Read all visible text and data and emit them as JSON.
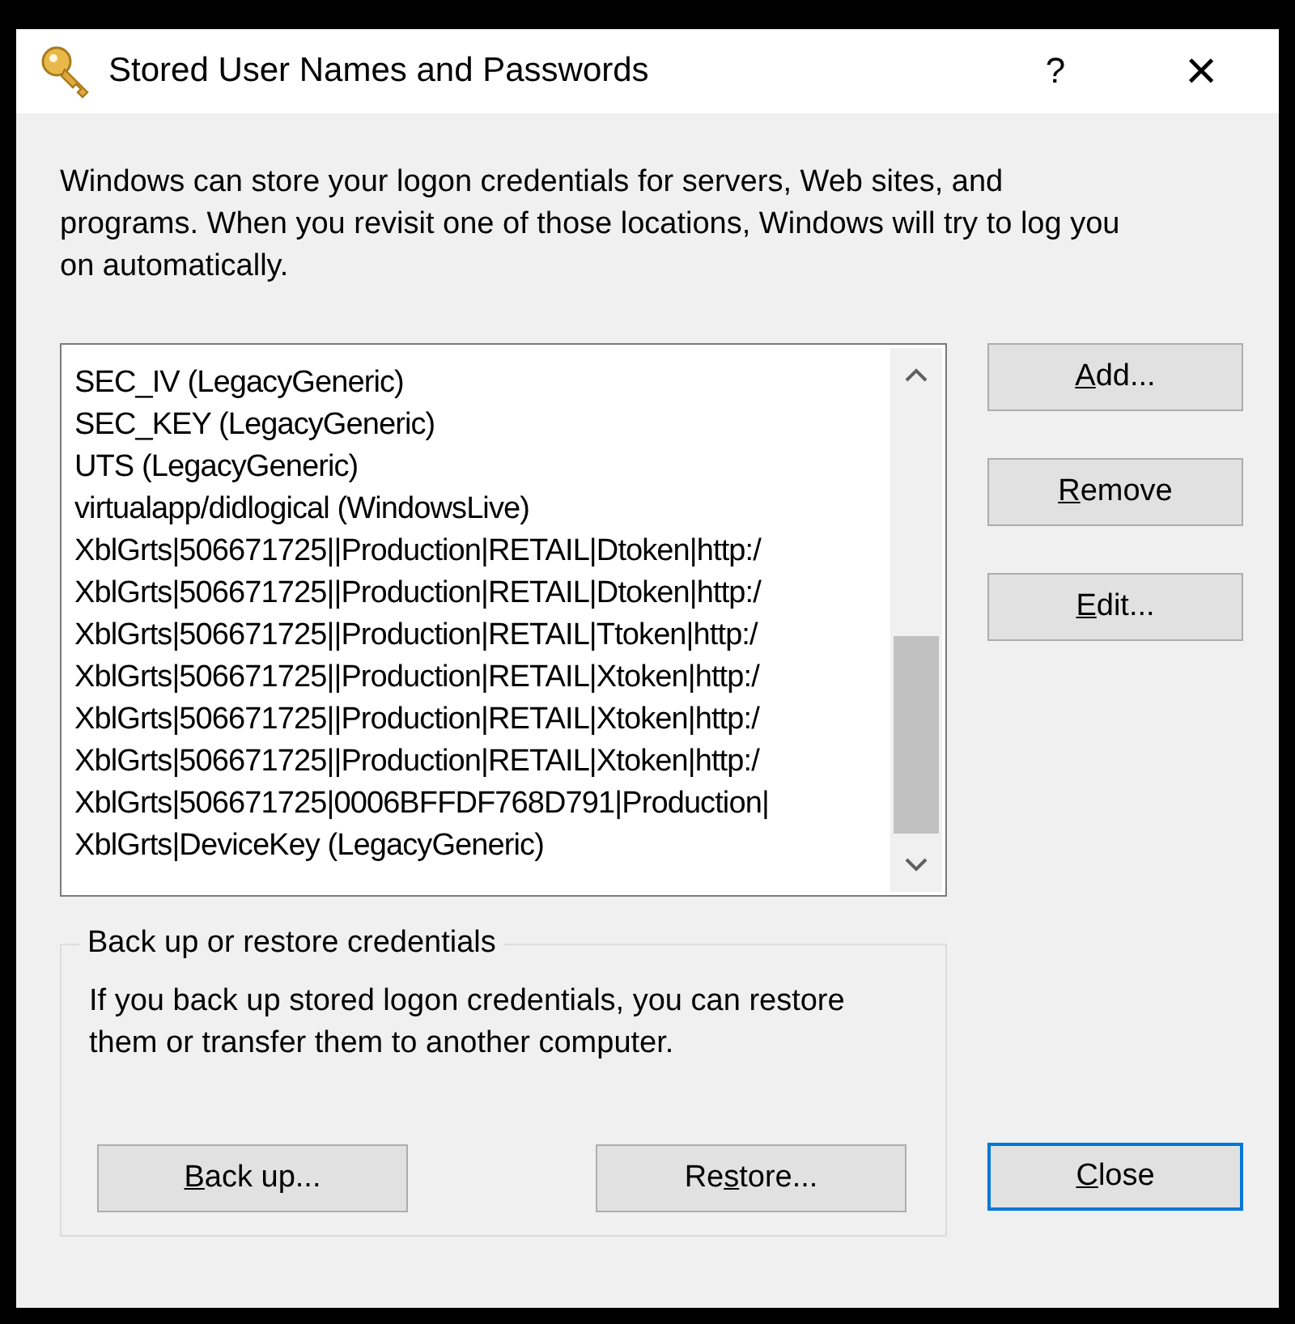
{
  "window": {
    "title": "Stored User Names and Passwords",
    "help": "?",
    "close": "×"
  },
  "description": "Windows can store your logon credentials for servers, Web sites, and programs. When you revisit one of those locations, Windows will try to log you on automatically.",
  "credentials": [
    {
      "name": "SEC_IV (LegacyGeneric)",
      "selected": false
    },
    {
      "name": "SEC_KEY (LegacyGeneric)",
      "selected": false
    },
    {
      "name": "UTS (LegacyGeneric)",
      "selected": false
    },
    {
      "name": "virtualapp/didlogical (WindowsLive)",
      "selected": false
    },
    {
      "name": "XblGrts|506671725||Production|RETAIL|Dtoken|http:/",
      "selected": false
    },
    {
      "name": "XblGrts|506671725||Production|RETAIL|Dtoken|http:/",
      "selected": false
    },
    {
      "name": "XblGrts|506671725||Production|RETAIL|Ttoken|http:/",
      "selected": false
    },
    {
      "name": "XblGrts|506671725||Production|RETAIL|Xtoken|http:/",
      "selected": false
    },
    {
      "name": "XblGrts|506671725||Production|RETAIL|Xtoken|http:/",
      "selected": false
    },
    {
      "name": "XblGrts|506671725||Production|RETAIL|Xtoken|http:/",
      "selected": false
    },
    {
      "name": "XblGrts|506671725|0006BFFDF768D791|Production|",
      "selected": false
    },
    {
      "name": "XblGrts|DeviceKey (LegacyGeneric)",
      "selected": false
    }
  ],
  "side_buttons": [
    {
      "label": {
        "key": "A",
        "after": "dd..."
      },
      "default": false
    },
    {
      "label": {
        "key": "R",
        "after": "emove"
      },
      "default": false
    },
    {
      "label": {
        "key": "E",
        "after": "dit..."
      },
      "default": false
    }
  ],
  "backup_group": {
    "title": "Back up or restore credentials",
    "text": "If you back up stored logon credentials, you can restore them or transfer them to another computer.",
    "buttons": [
      {
        "label": {
          "key": "B",
          "after": "ack up..."
        },
        "default": false
      },
      {
        "label": {
          "before": "Re",
          "key": "s",
          "after": "tore..."
        },
        "default": false
      }
    ]
  },
  "close_button": {
    "label": {
      "key": "C",
      "after": "lose"
    },
    "default": true
  }
}
